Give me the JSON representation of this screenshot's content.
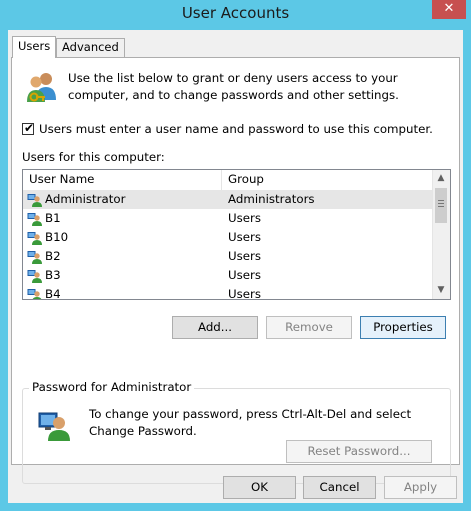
{
  "window": {
    "title": "User Accounts",
    "close_glyph": "✕"
  },
  "tabs": [
    {
      "label": "Users",
      "active": true
    },
    {
      "label": "Advanced",
      "active": false
    }
  ],
  "users_tab": {
    "intro_text": "Use the list below to grant or deny users access to your computer, and to change passwords and other settings.",
    "require_login": {
      "label": "Users must enter a user name and password to use this computer.",
      "checked": true
    },
    "list_label": "Users for this computer:",
    "columns": [
      "User Name",
      "Group"
    ],
    "rows": [
      {
        "name": "Administrator",
        "group": "Administrators",
        "selected": true
      },
      {
        "name": "B1",
        "group": "Users",
        "selected": false
      },
      {
        "name": "B10",
        "group": "Users",
        "selected": false
      },
      {
        "name": "B2",
        "group": "Users",
        "selected": false
      },
      {
        "name": "B3",
        "group": "Users",
        "selected": false
      },
      {
        "name": "B4",
        "group": "Users",
        "selected": false
      }
    ],
    "buttons": {
      "add": "Add...",
      "remove": "Remove",
      "properties": "Properties"
    },
    "password_group": {
      "title": "Password for Administrator",
      "text": "To change your password, press Ctrl-Alt-Del and select Change Password.",
      "reset_button": "Reset Password..."
    }
  },
  "dialog_buttons": {
    "ok": "OK",
    "cancel": "Cancel",
    "apply": "Apply"
  },
  "colors": {
    "frame": "#5cc8e6",
    "close": "#c75050",
    "selection": "#e6e6e6",
    "default_button_border": "#3c7fb1"
  },
  "icons": {
    "intro": "users-key-icon",
    "row": "user-icon",
    "password": "user-icon"
  }
}
